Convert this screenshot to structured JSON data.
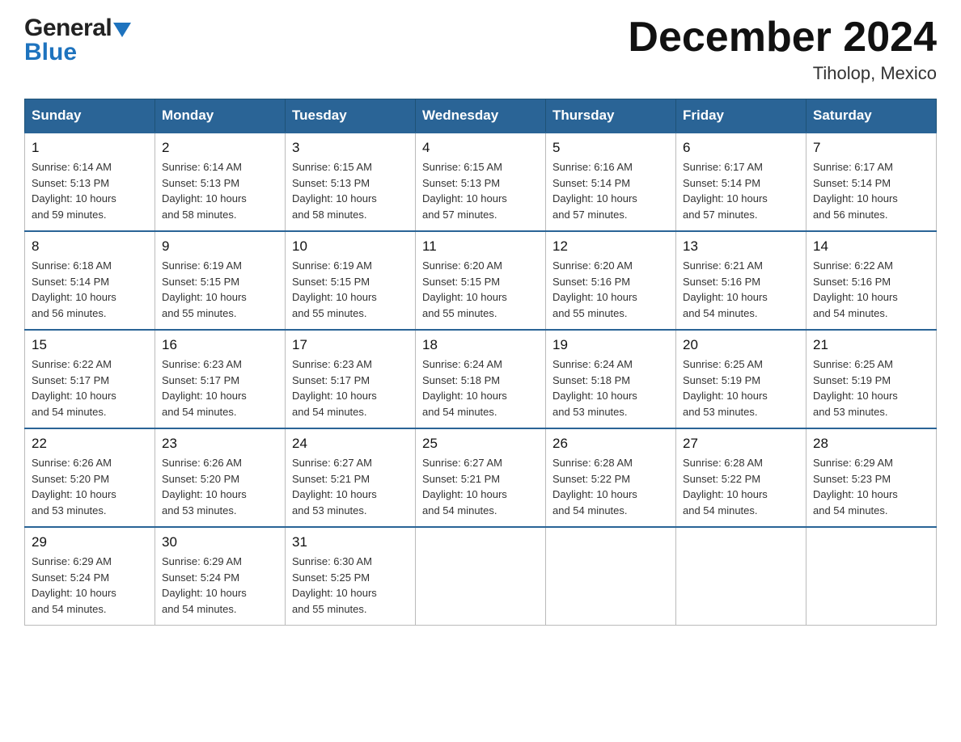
{
  "header": {
    "logo_general": "General",
    "logo_blue": "Blue",
    "title": "December 2024",
    "location": "Tiholop, Mexico"
  },
  "days_of_week": [
    "Sunday",
    "Monday",
    "Tuesday",
    "Wednesday",
    "Thursday",
    "Friday",
    "Saturday"
  ],
  "weeks": [
    [
      {
        "day": "1",
        "sunrise": "6:14 AM",
        "sunset": "5:13 PM",
        "daylight": "10 hours and 59 minutes."
      },
      {
        "day": "2",
        "sunrise": "6:14 AM",
        "sunset": "5:13 PM",
        "daylight": "10 hours and 58 minutes."
      },
      {
        "day": "3",
        "sunrise": "6:15 AM",
        "sunset": "5:13 PM",
        "daylight": "10 hours and 58 minutes."
      },
      {
        "day": "4",
        "sunrise": "6:15 AM",
        "sunset": "5:13 PM",
        "daylight": "10 hours and 57 minutes."
      },
      {
        "day": "5",
        "sunrise": "6:16 AM",
        "sunset": "5:14 PM",
        "daylight": "10 hours and 57 minutes."
      },
      {
        "day": "6",
        "sunrise": "6:17 AM",
        "sunset": "5:14 PM",
        "daylight": "10 hours and 57 minutes."
      },
      {
        "day": "7",
        "sunrise": "6:17 AM",
        "sunset": "5:14 PM",
        "daylight": "10 hours and 56 minutes."
      }
    ],
    [
      {
        "day": "8",
        "sunrise": "6:18 AM",
        "sunset": "5:14 PM",
        "daylight": "10 hours and 56 minutes."
      },
      {
        "day": "9",
        "sunrise": "6:19 AM",
        "sunset": "5:15 PM",
        "daylight": "10 hours and 55 minutes."
      },
      {
        "day": "10",
        "sunrise": "6:19 AM",
        "sunset": "5:15 PM",
        "daylight": "10 hours and 55 minutes."
      },
      {
        "day": "11",
        "sunrise": "6:20 AM",
        "sunset": "5:15 PM",
        "daylight": "10 hours and 55 minutes."
      },
      {
        "day": "12",
        "sunrise": "6:20 AM",
        "sunset": "5:16 PM",
        "daylight": "10 hours and 55 minutes."
      },
      {
        "day": "13",
        "sunrise": "6:21 AM",
        "sunset": "5:16 PM",
        "daylight": "10 hours and 54 minutes."
      },
      {
        "day": "14",
        "sunrise": "6:22 AM",
        "sunset": "5:16 PM",
        "daylight": "10 hours and 54 minutes."
      }
    ],
    [
      {
        "day": "15",
        "sunrise": "6:22 AM",
        "sunset": "5:17 PM",
        "daylight": "10 hours and 54 minutes."
      },
      {
        "day": "16",
        "sunrise": "6:23 AM",
        "sunset": "5:17 PM",
        "daylight": "10 hours and 54 minutes."
      },
      {
        "day": "17",
        "sunrise": "6:23 AM",
        "sunset": "5:17 PM",
        "daylight": "10 hours and 54 minutes."
      },
      {
        "day": "18",
        "sunrise": "6:24 AM",
        "sunset": "5:18 PM",
        "daylight": "10 hours and 54 minutes."
      },
      {
        "day": "19",
        "sunrise": "6:24 AM",
        "sunset": "5:18 PM",
        "daylight": "10 hours and 53 minutes."
      },
      {
        "day": "20",
        "sunrise": "6:25 AM",
        "sunset": "5:19 PM",
        "daylight": "10 hours and 53 minutes."
      },
      {
        "day": "21",
        "sunrise": "6:25 AM",
        "sunset": "5:19 PM",
        "daylight": "10 hours and 53 minutes."
      }
    ],
    [
      {
        "day": "22",
        "sunrise": "6:26 AM",
        "sunset": "5:20 PM",
        "daylight": "10 hours and 53 minutes."
      },
      {
        "day": "23",
        "sunrise": "6:26 AM",
        "sunset": "5:20 PM",
        "daylight": "10 hours and 53 minutes."
      },
      {
        "day": "24",
        "sunrise": "6:27 AM",
        "sunset": "5:21 PM",
        "daylight": "10 hours and 53 minutes."
      },
      {
        "day": "25",
        "sunrise": "6:27 AM",
        "sunset": "5:21 PM",
        "daylight": "10 hours and 54 minutes."
      },
      {
        "day": "26",
        "sunrise": "6:28 AM",
        "sunset": "5:22 PM",
        "daylight": "10 hours and 54 minutes."
      },
      {
        "day": "27",
        "sunrise": "6:28 AM",
        "sunset": "5:22 PM",
        "daylight": "10 hours and 54 minutes."
      },
      {
        "day": "28",
        "sunrise": "6:29 AM",
        "sunset": "5:23 PM",
        "daylight": "10 hours and 54 minutes."
      }
    ],
    [
      {
        "day": "29",
        "sunrise": "6:29 AM",
        "sunset": "5:24 PM",
        "daylight": "10 hours and 54 minutes."
      },
      {
        "day": "30",
        "sunrise": "6:29 AM",
        "sunset": "5:24 PM",
        "daylight": "10 hours and 54 minutes."
      },
      {
        "day": "31",
        "sunrise": "6:30 AM",
        "sunset": "5:25 PM",
        "daylight": "10 hours and 55 minutes."
      },
      null,
      null,
      null,
      null
    ]
  ],
  "labels": {
    "sunrise": "Sunrise:",
    "sunset": "Sunset:",
    "daylight": "Daylight:"
  }
}
